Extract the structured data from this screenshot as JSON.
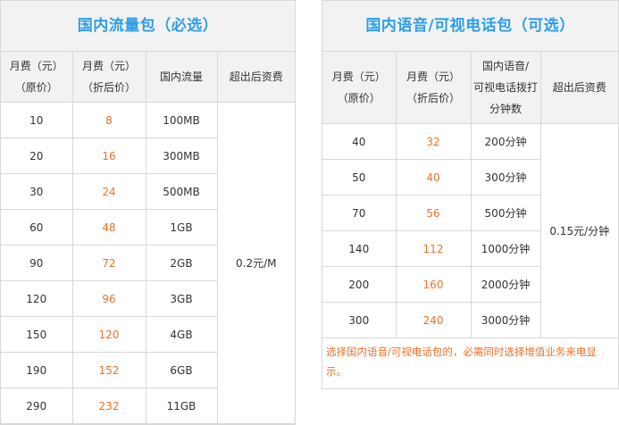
{
  "left": {
    "title": "国内流量包（必选）",
    "headers": {
      "monthly_fee_line1": "月费（元）",
      "monthly_fee_line2": "（原价）",
      "discount_fee_line1": "月费（元）",
      "discount_fee_line2": "（折后价）",
      "data": "国内流量",
      "overage": "超出后资费"
    },
    "overage_value": "0.2元/M",
    "rows": [
      {
        "orig": "10",
        "disc": "8",
        "amount": "100MB"
      },
      {
        "orig": "20",
        "disc": "16",
        "amount": "300MB"
      },
      {
        "orig": "30",
        "disc": "24",
        "amount": "500MB"
      },
      {
        "orig": "60",
        "disc": "48",
        "amount": "1GB"
      },
      {
        "orig": "90",
        "disc": "72",
        "amount": "2GB"
      },
      {
        "orig": "120",
        "disc": "96",
        "amount": "3GB"
      },
      {
        "orig": "150",
        "disc": "120",
        "amount": "4GB"
      },
      {
        "orig": "190",
        "disc": "152",
        "amount": "6GB"
      },
      {
        "orig": "290",
        "disc": "232",
        "amount": "11GB"
      }
    ]
  },
  "right": {
    "title": "国内语音/可视电话包（可选）",
    "headers": {
      "monthly_fee_line1": "月费（元）",
      "monthly_fee_line2": "（原价）",
      "discount_fee_line1": "月费（元）",
      "discount_fee_line2": "（折后价）",
      "minutes_line1": "国内语音/",
      "minutes_line2": "可视电话拨打",
      "minutes_line3": "分钟数",
      "overage": "超出后资费"
    },
    "overage_value": "0.15元/分钟",
    "rows": [
      {
        "orig": "40",
        "disc": "32",
        "amount": "200分钟"
      },
      {
        "orig": "50",
        "disc": "40",
        "amount": "300分钟"
      },
      {
        "orig": "70",
        "disc": "56",
        "amount": "500分钟"
      },
      {
        "orig": "140",
        "disc": "112",
        "amount": "1000分钟"
      },
      {
        "orig": "200",
        "disc": "160",
        "amount": "2000分钟"
      },
      {
        "orig": "300",
        "disc": "240",
        "amount": "3000分钟"
      }
    ],
    "note": "选择国内语音/可视电话包的，必需同时选择增值业务来电显示。"
  },
  "colors": {
    "title": "#2f9ee6",
    "discount": "#f07028",
    "header_bg": "#f2f2f2",
    "border": "#d9d9d9"
  }
}
